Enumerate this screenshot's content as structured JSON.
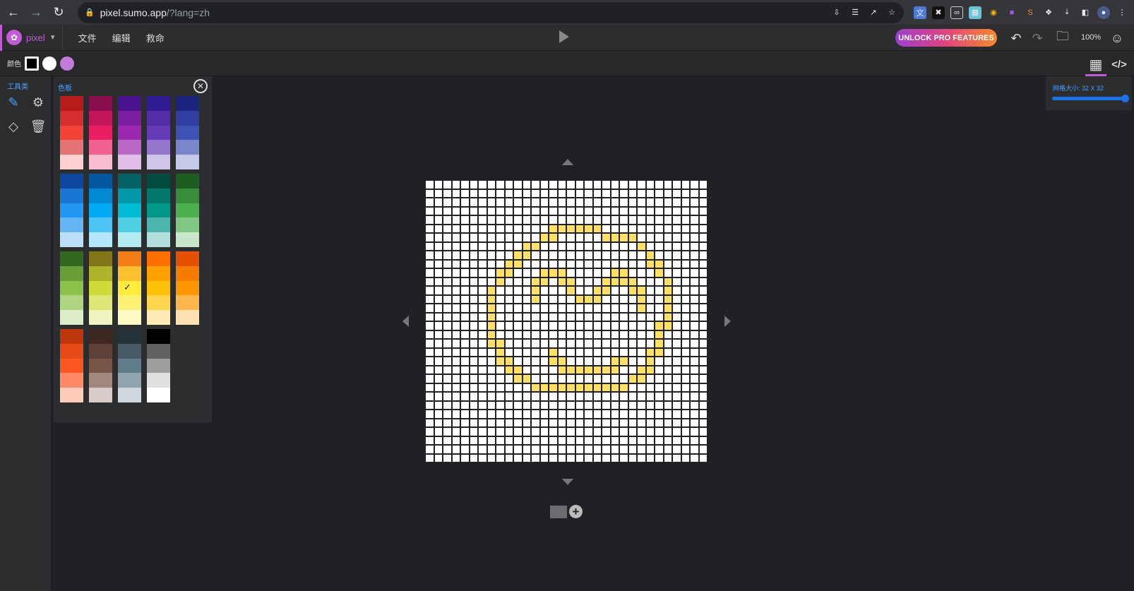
{
  "browser": {
    "url_host": "pixel.sumo.app",
    "url_path": "/?lang=zh"
  },
  "app": {
    "logo_label": "pixel",
    "menu": [
      "文件",
      "编辑",
      "救命"
    ],
    "pro_button": "UNLOCK PRO FEATURES",
    "zoom": "100%"
  },
  "colors_bar": {
    "label": "颜色",
    "primary": "#000000",
    "secondary": "#ffffff",
    "accent": "#c27bd6"
  },
  "tools": {
    "title": "工具类",
    "items": [
      "pencil-icon",
      "settings-icon",
      "eraser-icon",
      "trash-icon"
    ]
  },
  "palette": {
    "title": "色板",
    "selected": "#ffeb3b",
    "groups": [
      [
        [
          "#b71c1c",
          "#d32f2f",
          "#f44336",
          "#e57373",
          "#ffcdd2"
        ],
        [
          "#880e4f",
          "#c2185b",
          "#e91e63",
          "#f06292",
          "#f8bbd0"
        ],
        [
          "#4a148c",
          "#7b1fa2",
          "#9c27b0",
          "#ba68c8",
          "#e1bee7"
        ],
        [
          "#311b92",
          "#512da8",
          "#673ab7",
          "#9575cd",
          "#d1c4e9"
        ],
        [
          "#1a237e",
          "#303f9f",
          "#3f51b5",
          "#7986cb",
          "#c5cae9"
        ]
      ],
      [
        [
          "#0d47a1",
          "#1976d2",
          "#2196f3",
          "#64b5f6",
          "#bbdefb"
        ],
        [
          "#01579b",
          "#0288d1",
          "#03a9f4",
          "#4fc3f7",
          "#b3e5fc"
        ],
        [
          "#006064",
          "#0097a7",
          "#00bcd4",
          "#4dd0e1",
          "#b2ebf2"
        ],
        [
          "#004d40",
          "#00796b",
          "#009688",
          "#4db6ac",
          "#b2dfdb"
        ],
        [
          "#1b5e20",
          "#388e3c",
          "#4caf50",
          "#81c784",
          "#c8e6c9"
        ]
      ],
      [
        [
          "#33691e",
          "#689f38",
          "#8bc34a",
          "#aed581",
          "#dcedc8"
        ],
        [
          "#827717",
          "#afb42b",
          "#cddc39",
          "#dce775",
          "#f0f4c3"
        ],
        [
          "#f57f17",
          "#fbc02d",
          "#ffeb3b",
          "#fff176",
          "#fff9c4"
        ],
        [
          "#ff6f00",
          "#ffa000",
          "#ffc107",
          "#ffd54f",
          "#ffecb3"
        ],
        [
          "#e65100",
          "#f57c00",
          "#ff9800",
          "#ffb74d",
          "#ffe0b2"
        ]
      ],
      [
        [
          "#bf360c",
          "#e64a19",
          "#ff5722",
          "#ff8a65",
          "#ffccbc"
        ],
        [
          "#3e2723",
          "#5d4037",
          "#795548",
          "#a1887f",
          "#d7ccc8"
        ],
        [
          "#263238",
          "#455a64",
          "#607d8b",
          "#90a4ae",
          "#cfd8dc"
        ],
        [
          "#000000",
          "#616161",
          "#9e9e9e",
          "#e0e0e0",
          "#ffffff"
        ]
      ]
    ]
  },
  "canvas": {
    "grid_label": "网格大小: 32 X 32",
    "size": 32,
    "pixel_color": "#ffe066",
    "filled": [
      [
        5,
        14
      ],
      [
        5,
        15
      ],
      [
        5,
        16
      ],
      [
        5,
        17
      ],
      [
        5,
        18
      ],
      [
        5,
        19
      ],
      [
        6,
        13
      ],
      [
        6,
        14
      ],
      [
        6,
        20
      ],
      [
        6,
        21
      ],
      [
        6,
        22
      ],
      [
        6,
        23
      ],
      [
        7,
        11
      ],
      [
        7,
        12
      ],
      [
        7,
        24
      ],
      [
        8,
        10
      ],
      [
        8,
        11
      ],
      [
        8,
        25
      ],
      [
        9,
        9
      ],
      [
        9,
        10
      ],
      [
        9,
        25
      ],
      [
        9,
        26
      ],
      [
        10,
        8
      ],
      [
        10,
        9
      ],
      [
        10,
        13
      ],
      [
        10,
        14
      ],
      [
        10,
        15
      ],
      [
        10,
        21
      ],
      [
        10,
        22
      ],
      [
        10,
        26
      ],
      [
        11,
        8
      ],
      [
        11,
        12
      ],
      [
        11,
        13
      ],
      [
        11,
        15
      ],
      [
        11,
        16
      ],
      [
        11,
        20
      ],
      [
        11,
        21
      ],
      [
        11,
        22
      ],
      [
        11,
        23
      ],
      [
        11,
        27
      ],
      [
        12,
        7
      ],
      [
        12,
        12
      ],
      [
        12,
        16
      ],
      [
        12,
        19
      ],
      [
        12,
        20
      ],
      [
        12,
        23
      ],
      [
        12,
        24
      ],
      [
        12,
        27
      ],
      [
        13,
        7
      ],
      [
        13,
        12
      ],
      [
        13,
        17
      ],
      [
        13,
        18
      ],
      [
        13,
        19
      ],
      [
        13,
        24
      ],
      [
        13,
        27
      ],
      [
        14,
        7
      ],
      [
        14,
        24
      ],
      [
        14,
        27
      ],
      [
        15,
        7
      ],
      [
        15,
        27
      ],
      [
        16,
        7
      ],
      [
        16,
        26
      ],
      [
        16,
        27
      ],
      [
        17,
        7
      ],
      [
        17,
        26
      ],
      [
        18,
        7
      ],
      [
        18,
        8
      ],
      [
        18,
        26
      ],
      [
        19,
        8
      ],
      [
        19,
        14
      ],
      [
        19,
        25
      ],
      [
        19,
        26
      ],
      [
        20,
        8
      ],
      [
        20,
        9
      ],
      [
        20,
        14
      ],
      [
        20,
        15
      ],
      [
        20,
        21
      ],
      [
        20,
        22
      ],
      [
        20,
        25
      ],
      [
        21,
        9
      ],
      [
        21,
        10
      ],
      [
        21,
        15
      ],
      [
        21,
        16
      ],
      [
        21,
        17
      ],
      [
        21,
        18
      ],
      [
        21,
        19
      ],
      [
        21,
        20
      ],
      [
        21,
        21
      ],
      [
        21,
        24
      ],
      [
        21,
        25
      ],
      [
        22,
        10
      ],
      [
        22,
        11
      ],
      [
        22,
        23
      ],
      [
        22,
        24
      ],
      [
        23,
        12
      ],
      [
        23,
        13
      ],
      [
        23,
        14
      ],
      [
        23,
        15
      ],
      [
        23,
        16
      ],
      [
        23,
        17
      ],
      [
        23,
        18
      ],
      [
        23,
        19
      ],
      [
        23,
        20
      ],
      [
        23,
        21
      ],
      [
        23,
        22
      ]
    ]
  }
}
